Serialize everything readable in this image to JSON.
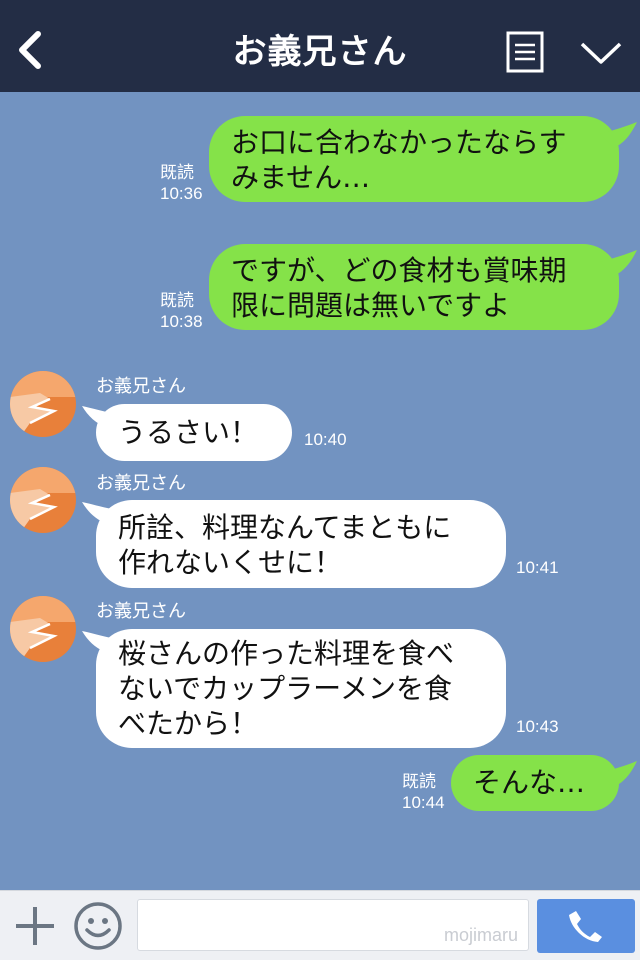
{
  "header": {
    "title": "お義兄さん",
    "back_icon": "chevron-left-icon",
    "menu_icon": "menu-list-icon",
    "collapse_icon": "chevron-down-icon"
  },
  "messages": [
    {
      "side": "right",
      "read": "既読",
      "time": "10:36",
      "lines": [
        "お口に合わなかったならす",
        "みません…"
      ]
    },
    {
      "side": "right",
      "read": "既読",
      "time": "10:38",
      "lines": [
        "ですが、どの食材も賞味期",
        "限に問題は無いですよ"
      ]
    },
    {
      "side": "left",
      "sender": "お義兄さん",
      "time": "10:40",
      "lines": [
        "うるさい！"
      ]
    },
    {
      "side": "left",
      "sender": "お義兄さん",
      "time": "10:41",
      "lines": [
        "所詮、料理なんてまともに",
        "作れないくせに！"
      ]
    },
    {
      "side": "left",
      "sender": "お義兄さん",
      "time": "10:43",
      "lines": [
        "桜さんの作った料理を食べ",
        "ないでカップラーメンを食",
        "べたから！"
      ]
    },
    {
      "side": "right",
      "read": "既読",
      "time": "10:44",
      "lines": [
        "そんな…"
      ]
    }
  ],
  "composer": {
    "watermark": "mojimaru",
    "plus_icon": "plus-icon",
    "emoji_icon": "smiley-icon",
    "call_icon": "phone-icon"
  },
  "colors": {
    "header_bg": "#232d45",
    "chat_bg": "#7293c1",
    "my_bubble": "#85e249",
    "their_bubble": "#ffffff",
    "call_button": "#5a8fe0"
  }
}
